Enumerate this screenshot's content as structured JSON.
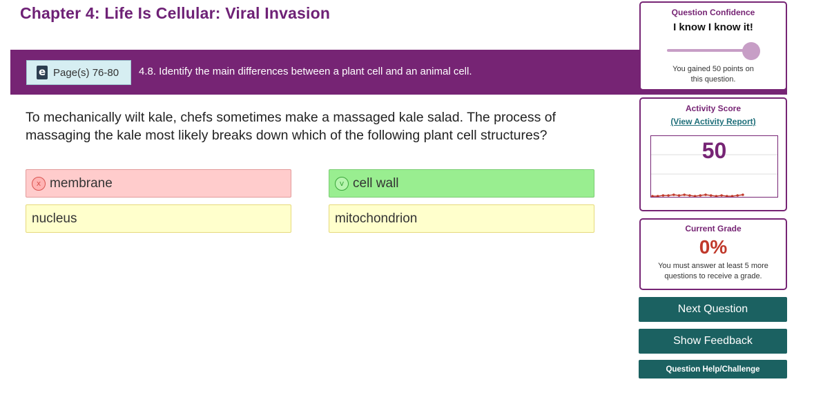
{
  "chapter_title": "Chapter 4: Life Is Cellular: Viral Invasion",
  "objective": {
    "pages_label": "Page(s) 76-80",
    "book_icon": "ebook-icon",
    "text": "4.8. Identify the main differences between a plant cell and an animal cell."
  },
  "question": {
    "text": "To mechanically wilt kale, chefs sometimes make a massaged kale salad. The process of massaging the kale most likely breaks down which of the following plant cell structures?",
    "answers": [
      {
        "label": "membrane",
        "state": "wrong",
        "mark": "x"
      },
      {
        "label": "cell wall",
        "state": "correct",
        "mark": "v"
      },
      {
        "label": "nucleus",
        "state": "neutral"
      },
      {
        "label": "mitochondrion",
        "state": "neutral"
      }
    ]
  },
  "confidence": {
    "title": "Question Confidence",
    "level_label": "I know I know it!",
    "slider_value": 1.0,
    "points_note": "You gained 50 points on this question."
  },
  "activity": {
    "title": "Activity Score",
    "report_link": "(View Activity Report)",
    "score": "50"
  },
  "grade": {
    "title": "Current Grade",
    "value": "0%",
    "note": "You must answer at least 5 more questions to receive a grade."
  },
  "buttons": {
    "next": "Next Question",
    "feedback": "Show Feedback",
    "help": "Question Help/Challenge"
  },
  "colors": {
    "brand_purple": "#762474",
    "button_teal": "#1b6161",
    "wrong_bg": "#ffcccc",
    "correct_bg": "#99ee90",
    "neutral_bg": "#ffffcc",
    "grade_red": "#c0392b"
  }
}
